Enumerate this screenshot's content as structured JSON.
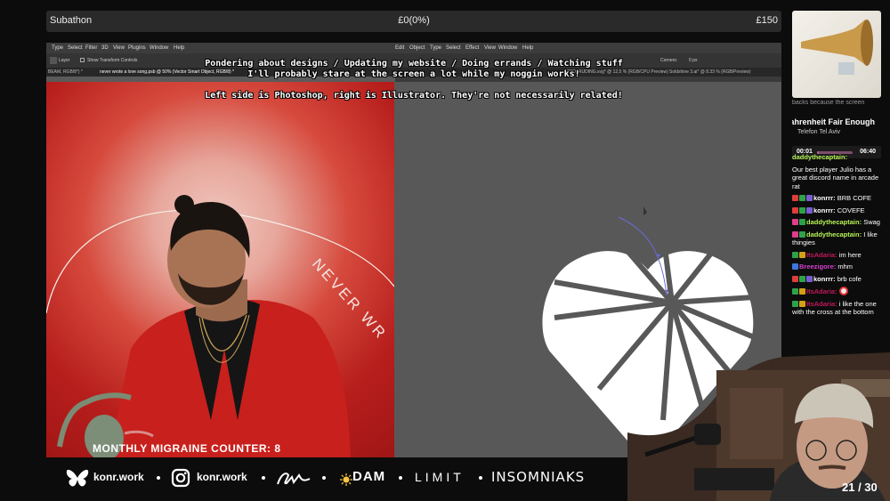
{
  "subathon": {
    "label": "Subathon",
    "progress_text": "£0(0%)",
    "goal": "£150",
    "progress": 0
  },
  "app_menu": {
    "ps_items": [
      "Type",
      "Select",
      "Filter",
      "3D",
      "View",
      "Plugins",
      "Window",
      "Help"
    ],
    "ai_items": [
      "Edit",
      "Object",
      "Type",
      "Select",
      "Effect",
      "View",
      "Window",
      "Help"
    ]
  },
  "toolbar": {
    "layer_label": "Layer",
    "transform_label": "Show Transform Controls",
    "corners_label": "Corners:",
    "corners_value": "0 px"
  },
  "tabs": {
    "tab1": "BEAM, RGB/8*) *",
    "tab2": "never wrote a love song.psb @ 50% (Vector Smart Object, RGB/8) *",
    "tab3": "PROTRUDING.svg* @ 12,5 % (RGB/CPU Preview)",
    "tab4": "Soldshine 3.ai* @ 8.33 % (RGB/Preview)"
  },
  "ruler_ticks": [
    "5400",
    "5300",
    "5200",
    "5100",
    "5000",
    "4900",
    "4800"
  ],
  "overlay": {
    "line1": "Pondering about designs / Updating my website / Doing errands / Watching stuff",
    "line2": "I'll probably stare at the screen a lot while my noggin works!",
    "line3": "Left side is Photoshop, right is Illustrator. They're not necessarily related!"
  },
  "artwork": {
    "curved_text": "NEVER WR"
  },
  "migraine": "MONTHLY MIGRAINE COUNTER: 8",
  "now_playing": {
    "scroll_text": "backs because the screen",
    "title": "Fahrenheit Fair Enough",
    "artist": "Telefon Tel Aviv",
    "current": "00:01",
    "total": "06:40",
    "progress": 0.05
  },
  "chat": [
    {
      "user": "daddythecaptain:",
      "text": "",
      "color": "#b6f255",
      "badges": []
    },
    {
      "user": "",
      "text": "Our best player Julio has a great discord name in arcade rat",
      "color": "#ffffff",
      "badges": []
    },
    {
      "user": "konrrr:",
      "text": "BRB COFE",
      "color": "#ffffff",
      "badges": [
        "#e03c3c",
        "#2ea24a",
        "#7a5bd0"
      ]
    },
    {
      "user": "konrrr:",
      "text": "COVEFE",
      "color": "#ffffff",
      "badges": [
        "#e03c3c",
        "#2ea24a",
        "#7a5bd0"
      ]
    },
    {
      "user": "daddythecaptain:",
      "text": "Swag",
      "color": "#b6f255",
      "badges": [
        "#e03c8c",
        "#2ea24a"
      ]
    },
    {
      "user": "daddythecaptain:",
      "text": "I like thingies",
      "color": "#b6f255",
      "badges": [
        "#e03c8c",
        "#2ea24a"
      ]
    },
    {
      "user": "ItsAdaria:",
      "text": "im here",
      "color": "#c2185b",
      "badges": [
        "#2ea24a",
        "#d4a017"
      ]
    },
    {
      "user": "Breezigore:",
      "text": "mhm",
      "color": "#d63fd0",
      "badges": [
        "#3a78e0"
      ]
    },
    {
      "user": "konrrr:",
      "text": "brb cofe",
      "color": "#ffffff",
      "badges": [
        "#e03c3c",
        "#2ea24a",
        "#7a5bd0"
      ]
    },
    {
      "user": "ItsAdaria:",
      "text": "",
      "color": "#c2185b",
      "badges": [
        "#2ea24a",
        "#d4a017"
      ]
    },
    {
      "user": "ItsAdaria:",
      "text": "i like the one with the cross at the bottom",
      "color": "#c2185b",
      "badges": [
        "#2ea24a",
        "#d4a017"
      ]
    }
  ],
  "bottom_bar": {
    "site1": "konr.work",
    "site2": "konr.work",
    "brand_dam": "DAM",
    "brand_limit": "LIMIT",
    "brand_insomniaks": "INSOMNIAKS"
  },
  "counter": "21 / 30"
}
